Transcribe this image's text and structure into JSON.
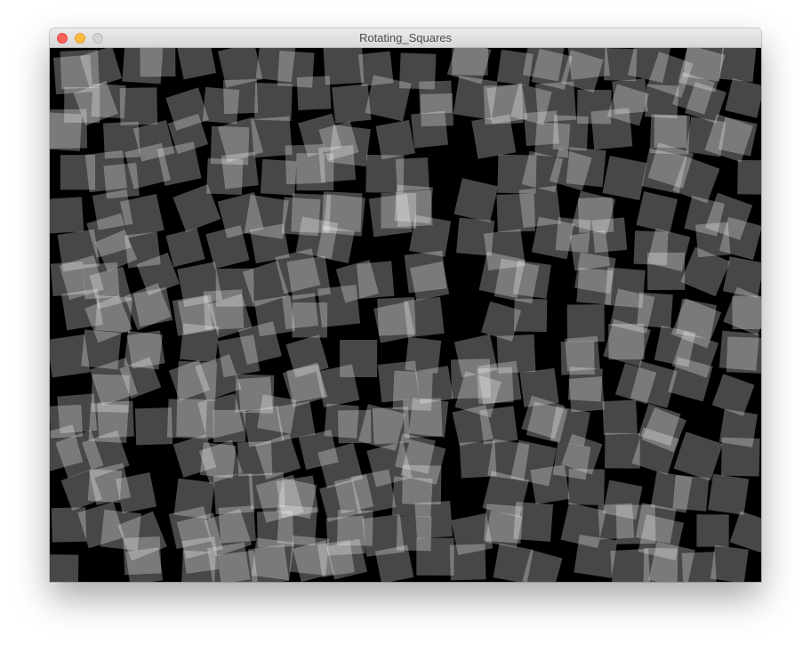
{
  "window": {
    "title": "Rotating_Squares",
    "controls": {
      "close": "close-icon",
      "minimize": "minimize-icon",
      "zoom": "zoom-icon"
    },
    "colors": {
      "close": "#fc605c",
      "minimize": "#fdbc40",
      "zoom": "#d3d3d3"
    }
  },
  "sketch": {
    "background": "#000000",
    "square_fill": "#ffffff",
    "square_opacity": 0.28
  }
}
